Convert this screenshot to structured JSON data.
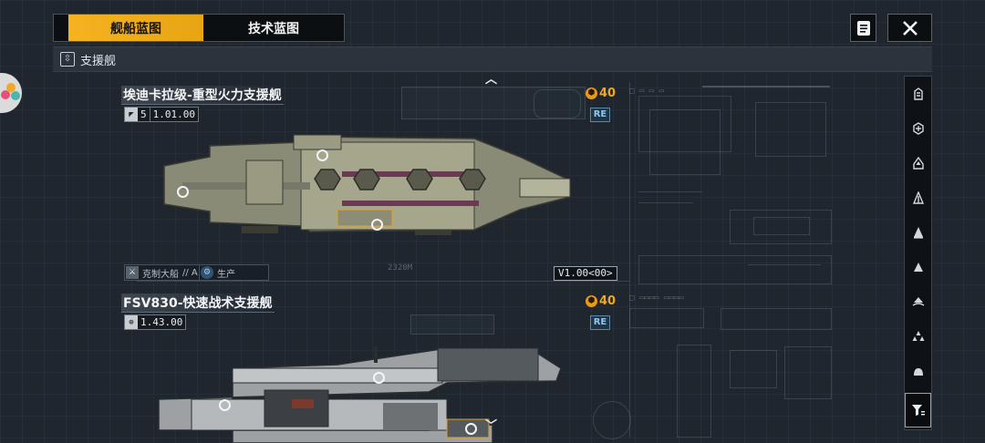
{
  "tabs": [
    {
      "label": "舰船蓝图",
      "active": true
    },
    {
      "label": "技术蓝图",
      "active": false
    }
  ],
  "toolbar": {
    "notes_icon": "document-icon",
    "close_icon": "close-icon"
  },
  "category": {
    "label": "支援舰",
    "icon": "support-ship-icon"
  },
  "ships": [
    {
      "name": "埃迪卡拉级-重型火力支援舰",
      "stat_icon": "ship-size-icon",
      "stat_a": "5",
      "stat_b": "1.01.00",
      "price": "40",
      "badge": "RE",
      "tag1_label": "克制大船",
      "tag1_value": "// A",
      "tag2_label": "生产",
      "version": "V1.00<00>",
      "length_label": "2320M"
    },
    {
      "name": "FSV830-快速战术支援舰",
      "stat_icon": "globe-icon",
      "stat_b": "1.43.00",
      "price": "40",
      "badge": "RE"
    }
  ],
  "rail": [
    {
      "icon": "all-ships-icon",
      "active": false
    },
    {
      "icon": "support-ship-icon",
      "active": false
    },
    {
      "icon": "carrier-icon",
      "active": false
    },
    {
      "icon": "destroyer-icon",
      "active": false
    },
    {
      "icon": "frigate-icon",
      "active": false
    },
    {
      "icon": "cruiser-icon",
      "active": false
    },
    {
      "icon": "battlecruiser-icon",
      "active": false
    },
    {
      "icon": "fighter-group-icon",
      "active": false
    },
    {
      "icon": "corvette-icon",
      "active": false
    },
    {
      "icon": "filter-icon",
      "active": true
    }
  ],
  "colors": {
    "accent": "#f2b11d",
    "background": "#1f262e",
    "badge": "#8ec8f0"
  }
}
